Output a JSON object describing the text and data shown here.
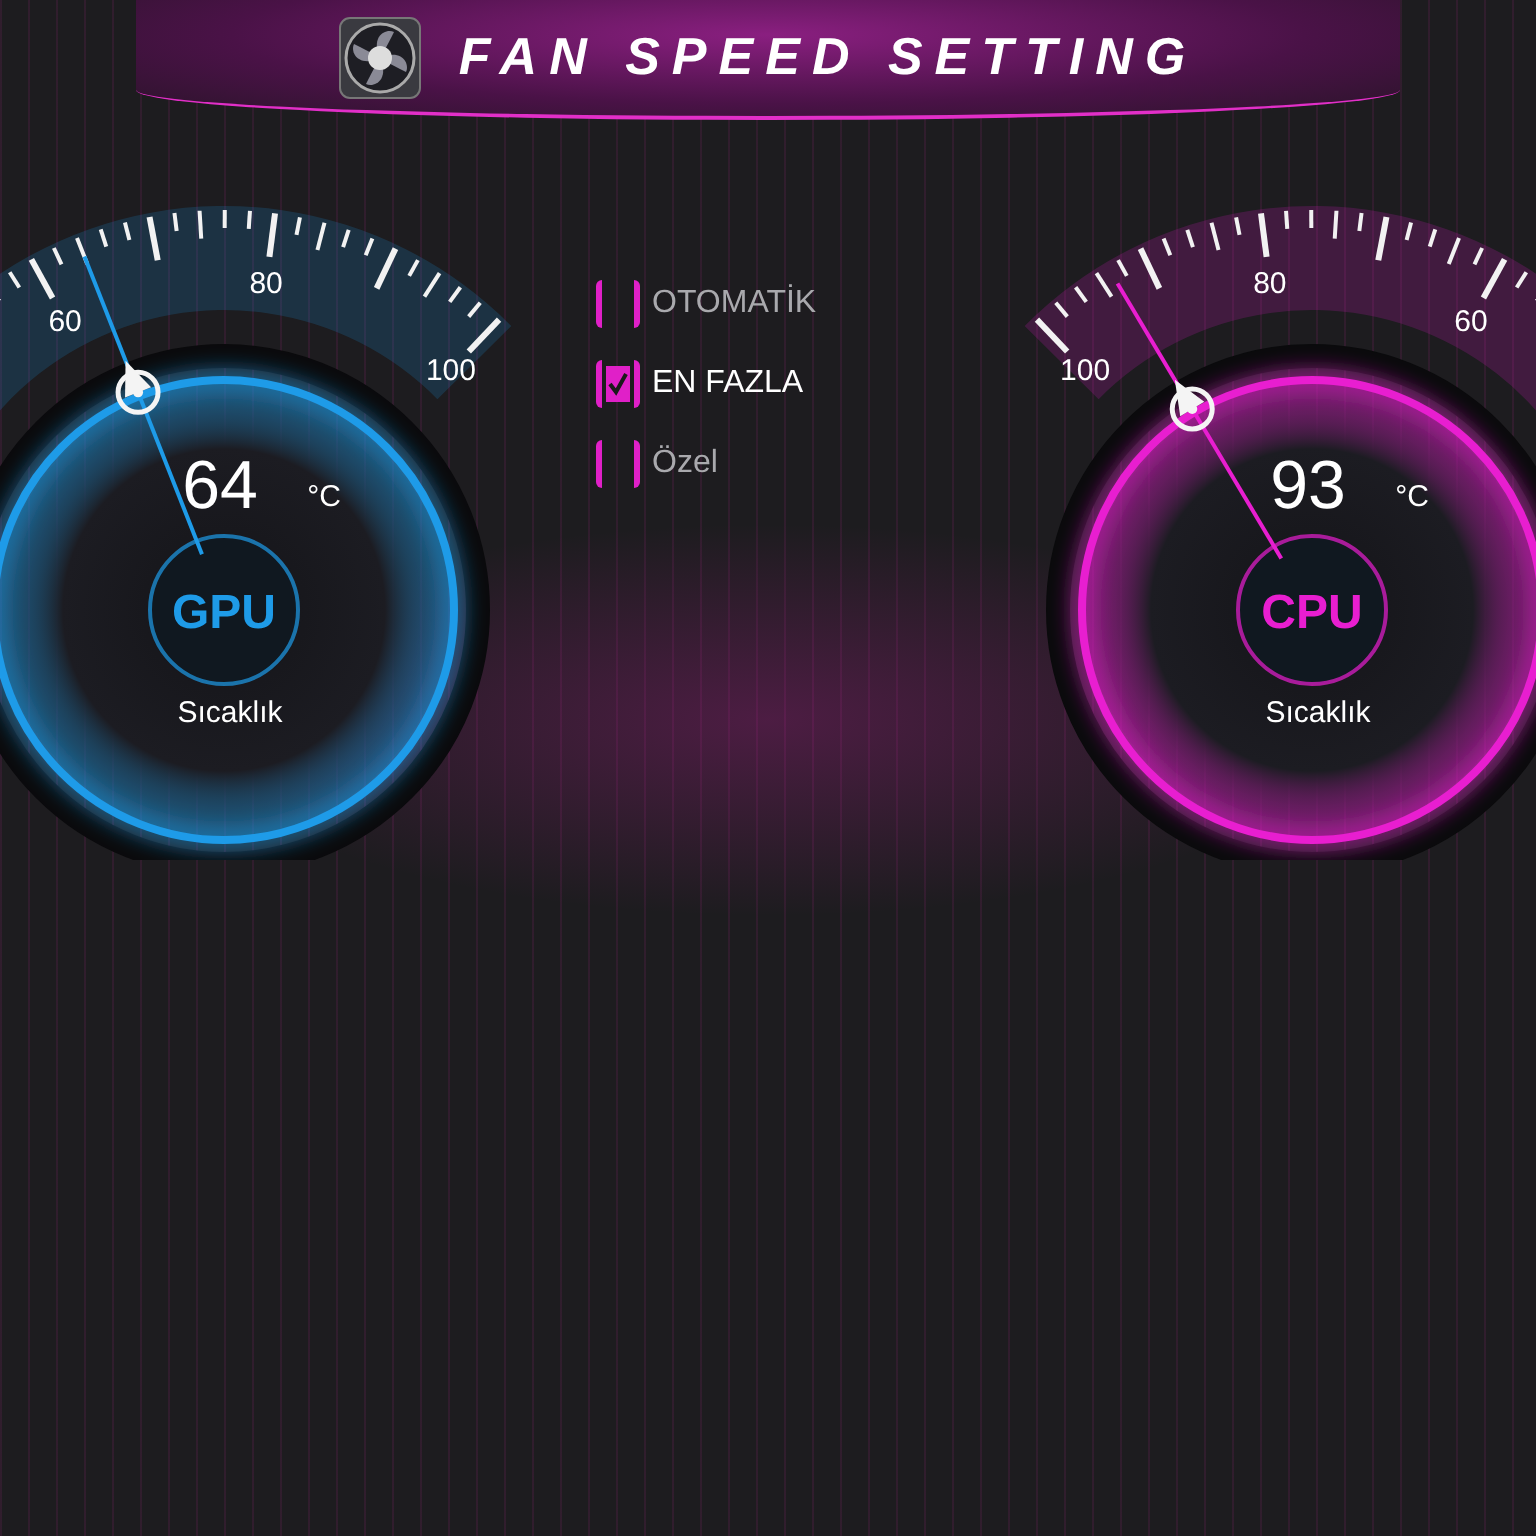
{
  "header": {
    "title": "FAN SPEED SETTING"
  },
  "gauges": [
    {
      "label": "GPU",
      "temperature": "64",
      "unit": "°C",
      "caption": "Sıcaklık",
      "scale_labels": [
        "60",
        "80",
        "100"
      ],
      "color": "#1e9be8"
    },
    {
      "label": "CPU",
      "temperature": "93",
      "unit": "°C",
      "caption": "Sıcaklık",
      "scale_labels": [
        "100",
        "80",
        "60"
      ],
      "color": "#e81ed0"
    }
  ],
  "modes": [
    {
      "label": "OTOMATİK",
      "checked": false
    },
    {
      "label": "EN FAZLA",
      "checked": true
    },
    {
      "label": "Özel",
      "checked": false
    }
  ]
}
